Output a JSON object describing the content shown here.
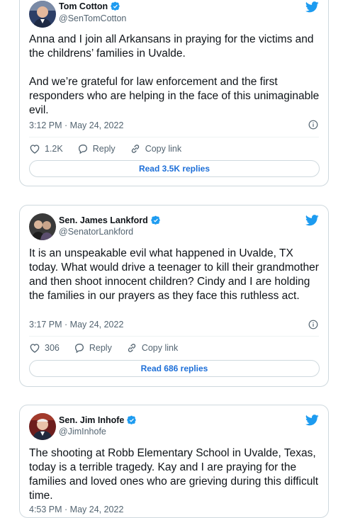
{
  "colors": {
    "accent": "#1d9bf0",
    "text": "#0f1419",
    "muted": "#536471",
    "border": "#cfd9de"
  },
  "tweets": [
    {
      "name": "Tom Cotton",
      "handle": "@SenTomCotton",
      "text": "Anna and I join all Arkansans in praying for the victims and the childrens’ families in Uvalde.\n\nAnd we’re grateful for law enforcement and the first responders who are helping in the face of this unimaginable evil.",
      "timestamp": "3:12 PM · May 24, 2022",
      "likes": "1.2K",
      "reply_label": "Reply",
      "copy_label": "Copy link",
      "read_replies": "Read 3.5K replies"
    },
    {
      "name": "Sen. James Lankford",
      "handle": "@SenatorLankford",
      "text": "It is an unspeakable evil what happened in Uvalde, TX today. What would drive a teenager to kill their grandmother and then shoot innocent children? Cindy and I are holding the families in our prayers as they face this ruthless act.",
      "timestamp": "3:17 PM · May 24, 2022",
      "likes": "306",
      "reply_label": "Reply",
      "copy_label": "Copy link",
      "read_replies": "Read 686 replies"
    },
    {
      "name": "Sen. Jim Inhofe",
      "handle": "@JimInhofe",
      "text": "The shooting at Robb Elementary School in Uvalde, Texas, today is a terrible tragedy. Kay and I are praying for the families and loved ones who are grieving during this difficult time.",
      "timestamp": "4:53 PM · May 24, 2022"
    }
  ]
}
